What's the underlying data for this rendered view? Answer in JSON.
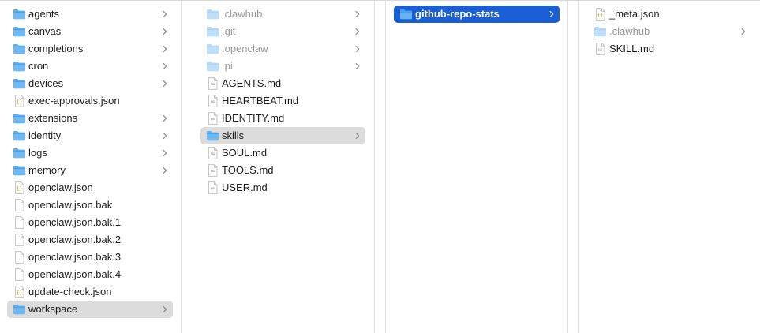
{
  "colors": {
    "folder": "#5aaef2",
    "selection_gray": "#dcdcdc",
    "selection_blue": "#1a5fd6",
    "chevron": "#8e8e8e"
  },
  "columns": [
    {
      "name": "root",
      "items": [
        {
          "label": "agents",
          "icon": "folder-icon",
          "chevron": true
        },
        {
          "label": "canvas",
          "icon": "folder-icon",
          "chevron": true
        },
        {
          "label": "completions",
          "icon": "folder-icon",
          "chevron": true
        },
        {
          "label": "cron",
          "icon": "folder-icon",
          "chevron": true
        },
        {
          "label": "devices",
          "icon": "folder-icon",
          "chevron": true
        },
        {
          "label": "exec-approvals.json",
          "icon": "json-file-icon",
          "chevron": false
        },
        {
          "label": "extensions",
          "icon": "folder-icon",
          "chevron": true
        },
        {
          "label": "identity",
          "icon": "folder-icon",
          "chevron": true
        },
        {
          "label": "logs",
          "icon": "folder-icon",
          "chevron": true
        },
        {
          "label": "memory",
          "icon": "folder-icon",
          "chevron": true
        },
        {
          "label": "openclaw.json",
          "icon": "json-file-icon",
          "chevron": false
        },
        {
          "label": "openclaw.json.bak",
          "icon": "blank-file-icon",
          "chevron": false
        },
        {
          "label": "openclaw.json.bak.1",
          "icon": "blank-file-icon",
          "chevron": false
        },
        {
          "label": "openclaw.json.bak.2",
          "icon": "blank-file-icon",
          "chevron": false
        },
        {
          "label": "openclaw.json.bak.3",
          "icon": "blank-file-icon",
          "chevron": false
        },
        {
          "label": "openclaw.json.bak.4",
          "icon": "blank-file-icon",
          "chevron": false
        },
        {
          "label": "update-check.json",
          "icon": "json-file-icon",
          "chevron": false
        },
        {
          "label": "workspace",
          "icon": "folder-icon",
          "chevron": true,
          "selected": "gray"
        }
      ]
    },
    {
      "name": "workspace",
      "items": [
        {
          "label": ".clawhub",
          "icon": "folder-icon",
          "chevron": true,
          "hidden": true
        },
        {
          "label": ".git",
          "icon": "folder-icon",
          "chevron": true,
          "hidden": true
        },
        {
          "label": ".openclaw",
          "icon": "folder-icon",
          "chevron": true,
          "hidden": true
        },
        {
          "label": ".pi",
          "icon": "folder-icon",
          "chevron": true,
          "hidden": true
        },
        {
          "label": "AGENTS.md",
          "icon": "md-file-icon",
          "chevron": false
        },
        {
          "label": "HEARTBEAT.md",
          "icon": "md-file-icon",
          "chevron": false
        },
        {
          "label": "IDENTITY.md",
          "icon": "md-file-icon",
          "chevron": false
        },
        {
          "label": "skills",
          "icon": "folder-icon",
          "chevron": true,
          "selected": "gray"
        },
        {
          "label": "SOUL.md",
          "icon": "md-file-icon",
          "chevron": false
        },
        {
          "label": "TOOLS.md",
          "icon": "md-file-icon",
          "chevron": false
        },
        {
          "label": "USER.md",
          "icon": "md-file-icon",
          "chevron": false
        }
      ]
    },
    {
      "name": "skills",
      "items": [
        {
          "label": "github-repo-stats",
          "icon": "folder-icon",
          "chevron": true,
          "selected": "blue"
        }
      ]
    },
    {
      "name": "github-repo-stats",
      "items": [
        {
          "label": "_meta.json",
          "icon": "json-file-icon",
          "chevron": false
        },
        {
          "label": ".clawhub",
          "icon": "folder-icon",
          "chevron": true,
          "hidden": true
        },
        {
          "label": "SKILL.md",
          "icon": "md-file-icon",
          "chevron": false
        }
      ]
    }
  ]
}
